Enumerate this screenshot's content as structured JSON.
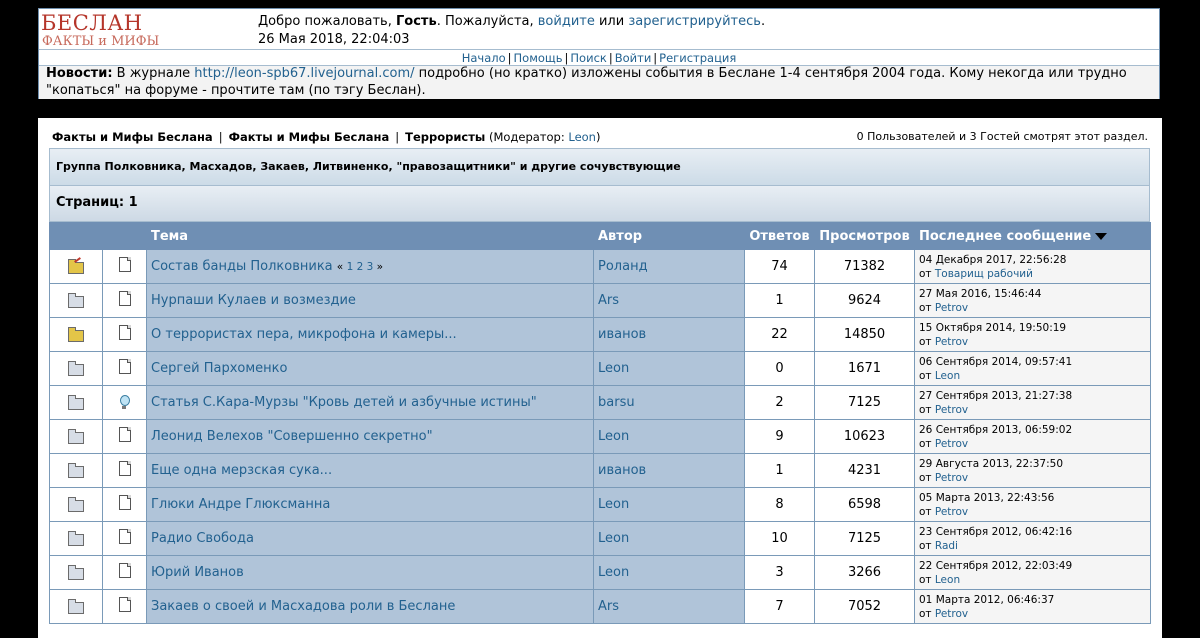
{
  "header": {
    "logo_line1": "БЕСЛАН",
    "logo_line2": "ФАКТЫ и МИФЫ",
    "welcome_prefix": "Добро пожаловать, ",
    "guest": "Гость",
    "please": ". Пожалуйста, ",
    "login_link": "войдите",
    "or": " или ",
    "register_link": "зарегистрируйтесь",
    "period": ".",
    "datetime": "26 Мая 2018, 22:04:03"
  },
  "topnav": [
    "Начало",
    "Помощь",
    "Поиск",
    "Войти",
    "Регистрация"
  ],
  "news": {
    "label": "Новости:",
    "text1": " В журнале ",
    "link": "http://leon-spb67.livejournal.com/",
    "text2": " подробно (но кратко) изложены события в Беслане 1-4 сентября 2004 года. Кому некогда или трудно \"копаться\" на форуме - прочтите там (по тэгу Беслан)."
  },
  "breadcrumb": {
    "item1": "Факты и Мифы Беслана",
    "item2": "Факты и Мифы Беслана",
    "item3": "Террористы",
    "moderator_prefix": "(Модератор: ",
    "moderator": "Leon",
    "moderator_suffix": ")"
  },
  "viewers": "0 Пользователей и 3 Гостей смотрят этот раздел.",
  "board_description": "Группа Полковника, Масхадов, Закаев, Литвиненко, \"правозащитники\" и другие сочувствующие",
  "pages_label": "Страниц: 1",
  "columns": {
    "subject": "Тема",
    "author": "Автор",
    "replies": "Ответов",
    "views": "Просмотров",
    "last_post": "Последнее сообщение"
  },
  "topics": [
    {
      "status_icon": "hot-note-folder-icon",
      "msg_icon": "document-icon",
      "subject": "Состав банды Полковника",
      "pages": [
        "1",
        "2",
        "3"
      ],
      "author": "Роланд",
      "replies": "74",
      "views": "71382",
      "last_date": "04 Декабря 2017, 22:56:28",
      "by": "от ",
      "last_user": "Товарищ рабочий"
    },
    {
      "status_icon": "folder-icon",
      "msg_icon": "document-icon",
      "subject": "Нурпаши Кулаев и возмездие",
      "author": "Ars",
      "replies": "1",
      "views": "9624",
      "last_date": "27 Мая 2016, 15:46:44",
      "by": "от ",
      "last_user": "Petrov"
    },
    {
      "status_icon": "hot-folder-icon",
      "msg_icon": "document-icon",
      "subject": "О террористах пера, микрофона и камеры...",
      "author": "иванов",
      "replies": "22",
      "views": "14850",
      "last_date": "15 Октября 2014, 19:50:19",
      "by": "от ",
      "last_user": "Petrov"
    },
    {
      "status_icon": "folder-icon",
      "msg_icon": "document-icon",
      "subject": "Сергей Пархоменко",
      "author": "Leon",
      "replies": "0",
      "views": "1671",
      "last_date": "06 Сентября 2014, 09:57:41",
      "by": "от ",
      "last_user": "Leon"
    },
    {
      "status_icon": "folder-icon",
      "msg_icon": "lightbulb-icon",
      "subject": "Статья С.Кара-Мурзы \"Кровь детей и азбучные истины\"",
      "author": "barsu",
      "replies": "2",
      "views": "7125",
      "last_date": "27 Сентября 2013, 21:27:38",
      "by": "от ",
      "last_user": "Petrov"
    },
    {
      "status_icon": "folder-icon",
      "msg_icon": "document-icon",
      "subject": "Леонид Велехов \"Совершенно секретно\"",
      "author": "Leon",
      "replies": "9",
      "views": "10623",
      "last_date": "26 Сентября 2013, 06:59:02",
      "by": "от ",
      "last_user": "Petrov"
    },
    {
      "status_icon": "folder-icon",
      "msg_icon": "document-icon",
      "subject": "Еще одна мерзская сука...",
      "author": "иванов",
      "replies": "1",
      "views": "4231",
      "last_date": "29 Августа 2013, 22:37:50",
      "by": "от ",
      "last_user": "Petrov"
    },
    {
      "status_icon": "folder-icon",
      "msg_icon": "document-icon",
      "subject": "Глюки Андре Глюксманна",
      "author": "Leon",
      "replies": "8",
      "views": "6598",
      "last_date": "05 Марта 2013, 22:43:56",
      "by": "от ",
      "last_user": "Petrov"
    },
    {
      "status_icon": "folder-icon",
      "msg_icon": "document-icon",
      "subject": "Радио Свобода",
      "author": "Leon",
      "replies": "10",
      "views": "7125",
      "last_date": "23 Сентября 2012, 06:42:16",
      "by": "от ",
      "last_user": "Radi"
    },
    {
      "status_icon": "folder-icon",
      "msg_icon": "document-icon",
      "subject": "Юрий Иванов",
      "author": "Leon",
      "replies": "3",
      "views": "3266",
      "last_date": "22 Сентября 2012, 22:03:49",
      "by": "от ",
      "last_user": "Leon"
    },
    {
      "status_icon": "folder-icon",
      "msg_icon": "document-icon",
      "subject": "Закаев о своей и Масхадова роли в Беслане",
      "author": "Ars",
      "replies": "7",
      "views": "7052",
      "last_date": "01 Марта 2012, 06:46:37",
      "by": "от ",
      "last_user": "Petrov"
    }
  ],
  "colors": {
    "link": "#22618f",
    "header_row": "#6f8fb4",
    "topic_cell": "#b0c4d9",
    "logo_red": "#b5352a"
  }
}
